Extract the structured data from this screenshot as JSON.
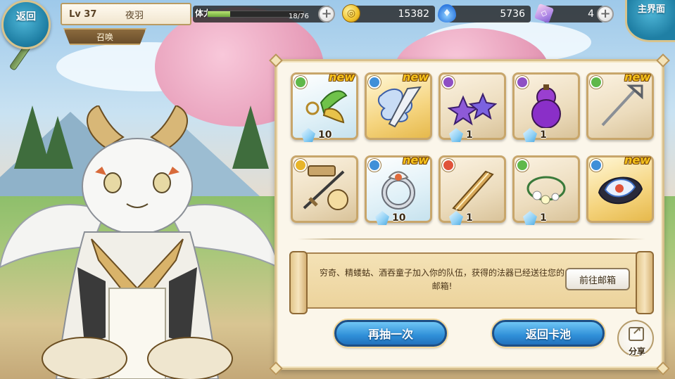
{
  "topbar": {
    "back_label": "返回",
    "level": "Lv 37",
    "player_name": "夜羽",
    "summon_label": "召唤",
    "stamina_label": "体力",
    "stamina_value": "18/76",
    "stamina_fraction": 0.237,
    "gold": "15382",
    "soul_fire": "5736",
    "crystal": "4",
    "home_label": "主界面"
  },
  "items": [
    {
      "name": "green-jade-earring",
      "element": "wind",
      "new": true,
      "qty": "10",
      "frame": "rare"
    },
    {
      "name": "blue-cloud-sword",
      "element": "water",
      "new": true,
      "qty": "",
      "frame": "epic"
    },
    {
      "name": "purple-star-earrings",
      "element": "dark",
      "new": false,
      "qty": "1",
      "frame": "norm"
    },
    {
      "name": "purple-gourd",
      "element": "dark",
      "new": false,
      "qty": "1",
      "frame": "norm"
    },
    {
      "name": "silver-rake-staff",
      "element": "wind",
      "new": true,
      "qty": "",
      "frame": "norm"
    },
    {
      "name": "hunter-dagger",
      "element": "light",
      "new": false,
      "qty": "",
      "frame": "norm"
    },
    {
      "name": "silver-ring",
      "element": "water",
      "new": true,
      "qty": "10",
      "frame": "rare"
    },
    {
      "name": "bronze-greatsword",
      "element": "fire",
      "new": false,
      "qty": "1",
      "frame": "norm"
    },
    {
      "name": "flower-bracelet",
      "element": "wind",
      "new": false,
      "qty": "1",
      "frame": "norm"
    },
    {
      "name": "blue-fox-fan",
      "element": "water",
      "new": true,
      "qty": "",
      "frame": "epic"
    }
  ],
  "new_tag": "new",
  "message": "穷奇、精蝼蛄、酒吞童子加入你的队伍，获得的法器已经送往您的邮箱!",
  "mailbox_button": "前往邮箱",
  "draw_again_button": "再抽一次",
  "return_pool_button": "返回卡池",
  "share_label": "分享",
  "colors": {
    "wind": "#5fb84a",
    "water": "#3f8fd8",
    "dark": "#8e4fc4",
    "light": "#e8b52a",
    "fire": "#e0533a",
    "button_blue": "#2f8fd8",
    "panel_border": "#d8c08d"
  }
}
